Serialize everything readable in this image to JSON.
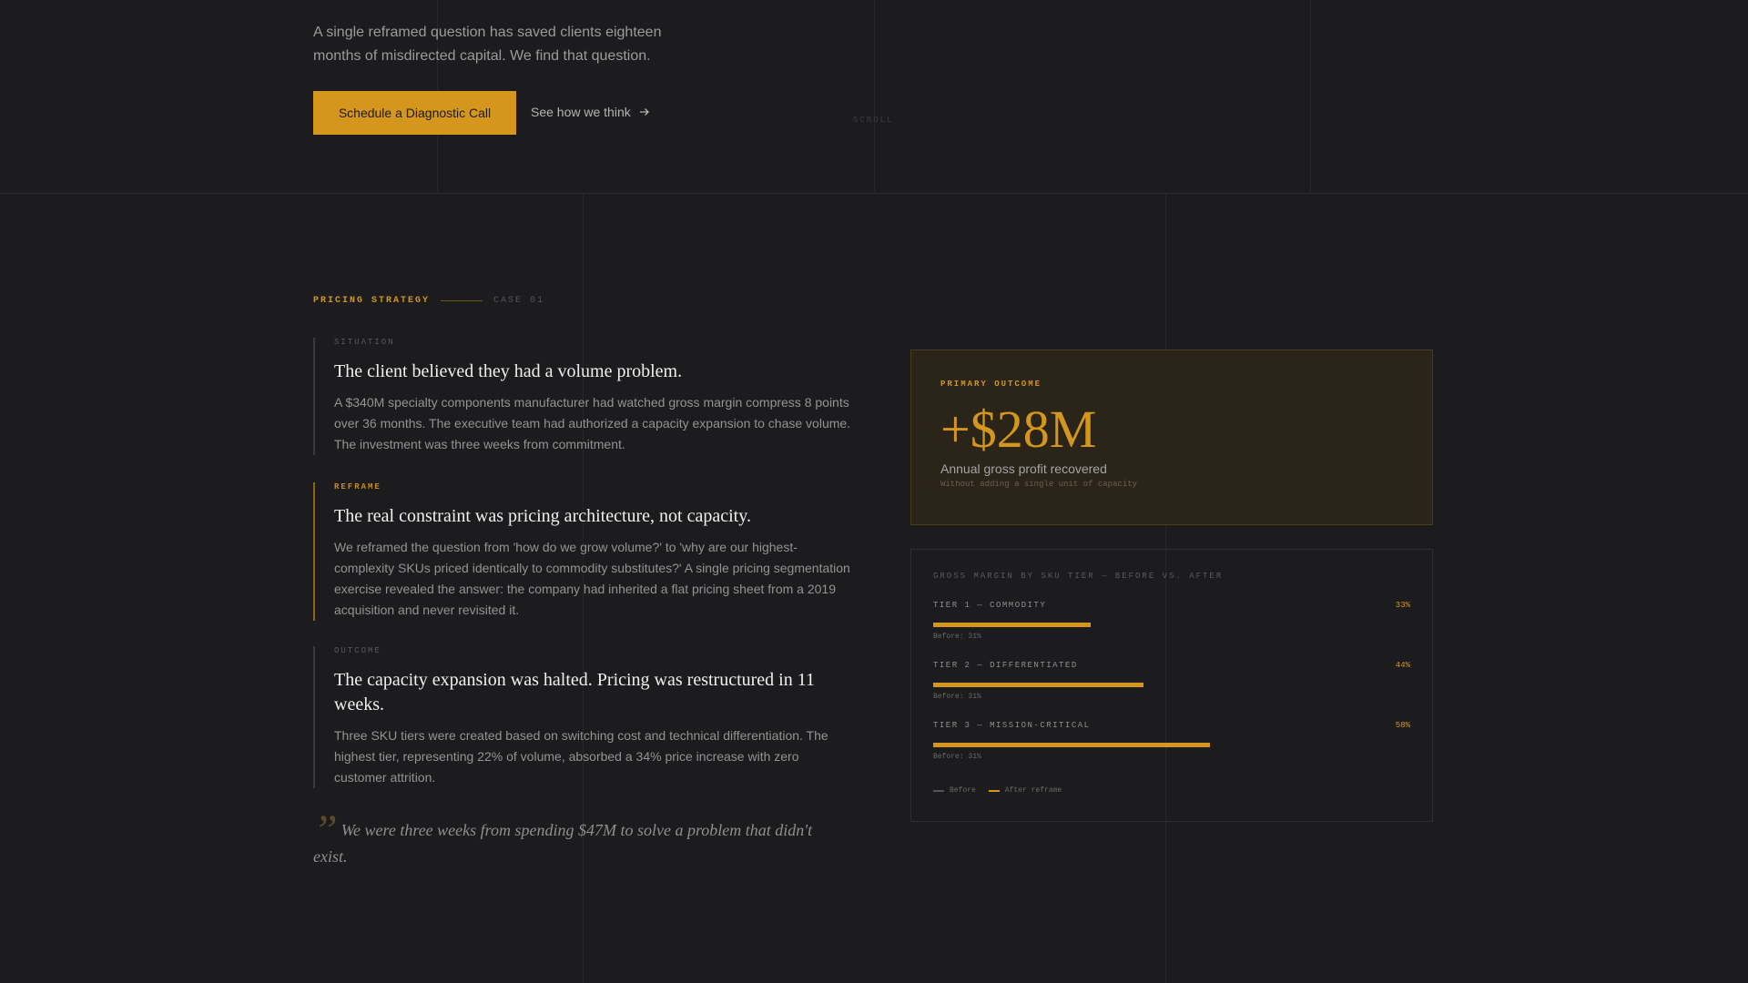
{
  "hero": {
    "subtitle": "A single reframed question has saved clients eighteen months of misdirected capital. We find that question.",
    "primary_button": "Schedule a Diagnostic Call",
    "secondary_link": "See how we think",
    "scroll_label": "SCROLL"
  },
  "case": {
    "tag": "PRICING STRATEGY",
    "number": "CASE 01"
  },
  "blocks": [
    {
      "label": "SITUATION",
      "title": "The client believed they had a volume problem.",
      "body": "A $340M specialty components manufacturer had watched gross margin compress 8 points over 36 months. The executive team had authorized a capacity expansion to chase volume. The investment was three weeks from commitment."
    },
    {
      "label": "REFRAME",
      "title": "The real constraint was pricing architecture, not capacity.",
      "body": "We reframed the question from 'how do we grow volume?' to 'why are our highest-complexity SKUs priced identically to commodity substitutes?' A single pricing segmentation exercise revealed the answer: the company had inherited a flat pricing sheet from a 2019 acquisition and never revisited it."
    },
    {
      "label": "OUTCOME",
      "title": "The capacity expansion was halted. Pricing was restructured in 11 weeks.",
      "body": "Three SKU tiers were created based on switching cost and technical differentiation. The highest tier, representing 22% of volume, absorbed a 34% price increase with zero customer attrition."
    }
  ],
  "quote": {
    "mark": "”",
    "text": "We were three weeks from spending $47M to solve a problem that didn't exist."
  },
  "outcome": {
    "label": "PRIMARY OUTCOME",
    "value": "+$28M",
    "description": "Annual gross profit recovered",
    "note": "Without adding a single unit of capacity"
  },
  "chart_data": {
    "type": "bar",
    "title": "GROSS MARGIN BY SKU TIER — BEFORE VS. AFTER",
    "categories": [
      "TIER 1 — COMMODITY",
      "TIER 2 — DIFFERENTIATED",
      "TIER 3 — MISSION-CRITICAL"
    ],
    "series": [
      {
        "name": "Before",
        "values": [
          31,
          31,
          31
        ]
      },
      {
        "name": "After reframe",
        "values": [
          33,
          44,
          58
        ]
      }
    ],
    "value_labels": [
      "33%",
      "44%",
      "58%"
    ],
    "before_labels": [
      "Before: 31%",
      "Before: 31%",
      "Before: 31%"
    ],
    "legend": [
      "Before",
      "After reframe"
    ],
    "ylim": [
      0,
      100
    ],
    "colors": {
      "before": "#555555",
      "after": "#d4961c"
    }
  }
}
